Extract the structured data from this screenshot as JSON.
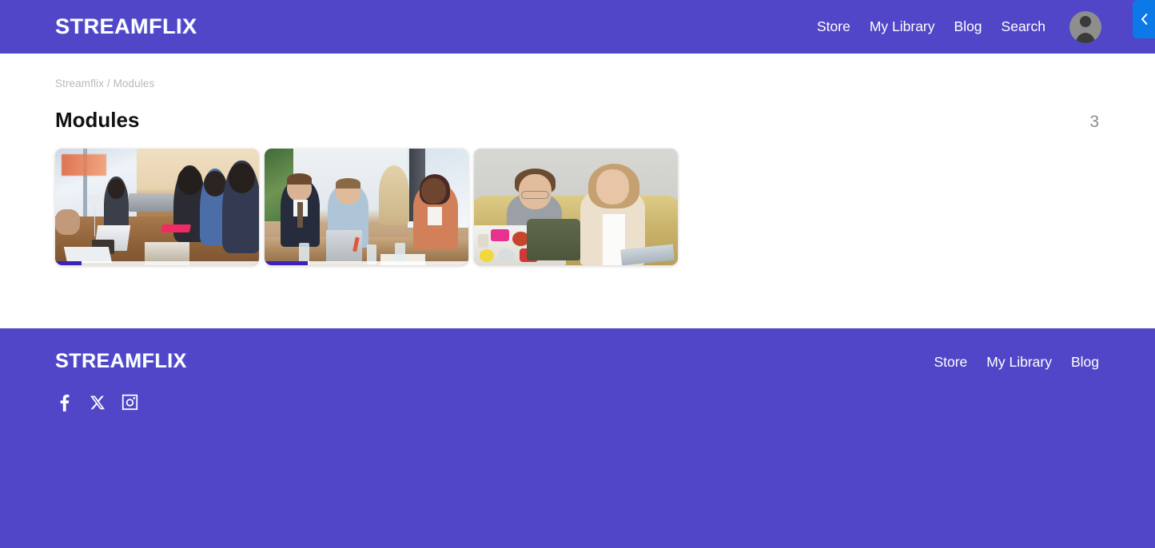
{
  "header": {
    "brand": "STREAMFLIX",
    "nav": [
      {
        "label": "Store"
      },
      {
        "label": "My Library"
      },
      {
        "label": "Blog"
      },
      {
        "label": "Search"
      }
    ],
    "avatar_name": "user-avatar",
    "side_tab_icon": "chevron-left-icon",
    "bg_color": "#5146c8",
    "side_tab_color": "#0b7ae8"
  },
  "main": {
    "breadcrumb": "Streamflix / Modules",
    "title": "Modules",
    "count": "3",
    "cards": [
      {
        "alt": "Group of professionals seated around a conference table in a meeting",
        "progress_percent": 13,
        "has_progress": true
      },
      {
        "alt": "Three colleagues talking across a bright modern meeting room table",
        "progress_percent": 21,
        "has_progress": true
      },
      {
        "alt": "Two young people sitting on a yellow couch with a sticker covered laptop",
        "progress_percent": 0,
        "has_progress": false
      }
    ],
    "progress_color": "#3b22b8"
  },
  "footer": {
    "brand": "STREAMFLIX",
    "nav": [
      {
        "label": "Store"
      },
      {
        "label": "My Library"
      },
      {
        "label": "Blog"
      }
    ],
    "socials": [
      {
        "name": "facebook-icon"
      },
      {
        "name": "x-twitter-icon"
      },
      {
        "name": "instagram-icon"
      }
    ],
    "bg_color": "#5146c8"
  }
}
